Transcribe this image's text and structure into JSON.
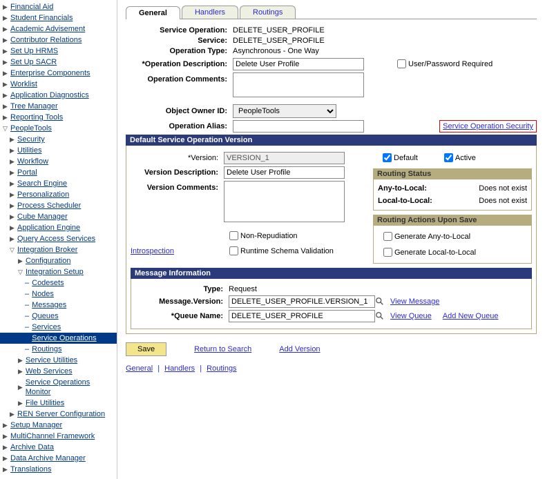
{
  "sidebar": [
    {
      "label": "Financial Aid",
      "icon": "▶",
      "depth": 0
    },
    {
      "label": "Student Financials",
      "icon": "▶",
      "depth": 0
    },
    {
      "label": "Academic Advisement",
      "icon": "▶",
      "depth": 0
    },
    {
      "label": "Contributor Relations",
      "icon": "▶",
      "depth": 0
    },
    {
      "label": "Set Up HRMS",
      "icon": "▶",
      "depth": 0
    },
    {
      "label": "Set Up SACR",
      "icon": "▶",
      "depth": 0
    },
    {
      "label": "Enterprise Components",
      "icon": "▶",
      "depth": 0
    },
    {
      "label": "Worklist",
      "icon": "▶",
      "depth": 0
    },
    {
      "label": "Application Diagnostics",
      "icon": "▶",
      "depth": 0
    },
    {
      "label": "Tree Manager",
      "icon": "▶",
      "depth": 0
    },
    {
      "label": "Reporting Tools",
      "icon": "▶",
      "depth": 0
    },
    {
      "label": "PeopleTools",
      "icon": "▽",
      "depth": 0
    },
    {
      "label": "Security",
      "icon": "▶",
      "depth": 1
    },
    {
      "label": "Utilities",
      "icon": "▶",
      "depth": 1
    },
    {
      "label": "Workflow",
      "icon": "▶",
      "depth": 1
    },
    {
      "label": "Portal",
      "icon": "▶",
      "depth": 1
    },
    {
      "label": "Search Engine",
      "icon": "▶",
      "depth": 1
    },
    {
      "label": "Personalization",
      "icon": "▶",
      "depth": 1
    },
    {
      "label": "Process Scheduler",
      "icon": "▶",
      "depth": 1
    },
    {
      "label": "Cube Manager",
      "icon": "▶",
      "depth": 1
    },
    {
      "label": "Application Engine",
      "icon": "▶",
      "depth": 1
    },
    {
      "label": "Query Access Services",
      "icon": "▶",
      "depth": 1
    },
    {
      "label": "Integration Broker",
      "icon": "▽",
      "depth": 1
    },
    {
      "label": "Configuration",
      "icon": "▶",
      "depth": 2
    },
    {
      "label": "Integration Setup",
      "icon": "▽",
      "depth": 2
    },
    {
      "label": "Codesets",
      "icon": "–",
      "depth": 3
    },
    {
      "label": "Nodes",
      "icon": "–",
      "depth": 3
    },
    {
      "label": "Messages",
      "icon": "–",
      "depth": 3
    },
    {
      "label": "Queues",
      "icon": "–",
      "depth": 3
    },
    {
      "label": "Services",
      "icon": "–",
      "depth": 3
    },
    {
      "label": "Service Operations",
      "icon": "–",
      "depth": 3,
      "selected": true
    },
    {
      "label": "Routings",
      "icon": "–",
      "depth": 3
    },
    {
      "label": "Service Utilities",
      "icon": "▶",
      "depth": 2
    },
    {
      "label": "Web Services",
      "icon": "▶",
      "depth": 2
    },
    {
      "label": "Service Operations Monitor",
      "icon": "▶",
      "depth": 2
    },
    {
      "label": "File Utilities",
      "icon": "▶",
      "depth": 2
    },
    {
      "label": "REN Server Configuration",
      "icon": "▶",
      "depth": 1
    },
    {
      "label": "Setup Manager",
      "icon": "▶",
      "depth": 0
    },
    {
      "label": "MultiChannel Framework",
      "icon": "▶",
      "depth": 0
    },
    {
      "label": "Archive Data",
      "icon": "▶",
      "depth": 0
    },
    {
      "label": "Data Archive Manager",
      "icon": "▶",
      "depth": 0
    },
    {
      "label": "Translations",
      "icon": "▶",
      "depth": 0
    }
  ],
  "tabs": {
    "general": "General",
    "handlers": "Handlers",
    "routings": "Routings"
  },
  "labels": {
    "service_operation": "Service Operation:",
    "service": "Service:",
    "operation_type": "Operation Type:",
    "operation_description": "*Operation Description:",
    "operation_comments": "Operation Comments:",
    "object_owner_id": "Object Owner ID:",
    "operation_alias": "Operation Alias:",
    "user_pwd_required": "User/Password Required",
    "svc_op_security": "Service Operation Security",
    "default_version_hdr": "Default Service Operation Version",
    "version": "*Version:",
    "version_description": "Version Description:",
    "version_comments": "Version Comments:",
    "default": "Default",
    "active": "Active",
    "routing_status": "Routing Status",
    "any_to_local": "Any-to-Local:",
    "local_to_local": "Local-to-Local:",
    "does_not_exist": "Does not exist",
    "routing_actions": "Routing Actions Upon Save",
    "gen_any_to_local": "Generate Any-to-Local",
    "gen_local_to_local": "Generate Local-to-Local",
    "non_repudiation": "Non-Repudiation",
    "runtime_schema": "Runtime Schema Validation",
    "introspection": "Introspection",
    "message_info": "Message Information",
    "type": "Type:",
    "request": "Request",
    "message_version": "Message.Version:",
    "queue_name": "*Queue Name:",
    "view_message": "View Message",
    "view_queue": "View Queue",
    "add_new_queue": "Add New Queue",
    "save": "Save",
    "return_to_search": "Return to Search",
    "add_version": "Add Version"
  },
  "values": {
    "service_operation": "DELETE_USER_PROFILE",
    "service": "DELETE_USER_PROFILE",
    "operation_type": "Asynchronous - One Way",
    "operation_description": "Delete User Profile",
    "object_owner_id": "PeopleTools",
    "operation_alias": "",
    "version": "VERSION_1",
    "version_description": "Delete User Profile",
    "message_version": "DELETE_USER_PROFILE.VERSION_1",
    "queue_name": "DELETE_USER_PROFILE"
  },
  "bottom": {
    "general": "General",
    "handlers": "Handlers",
    "routings": "Routings"
  }
}
